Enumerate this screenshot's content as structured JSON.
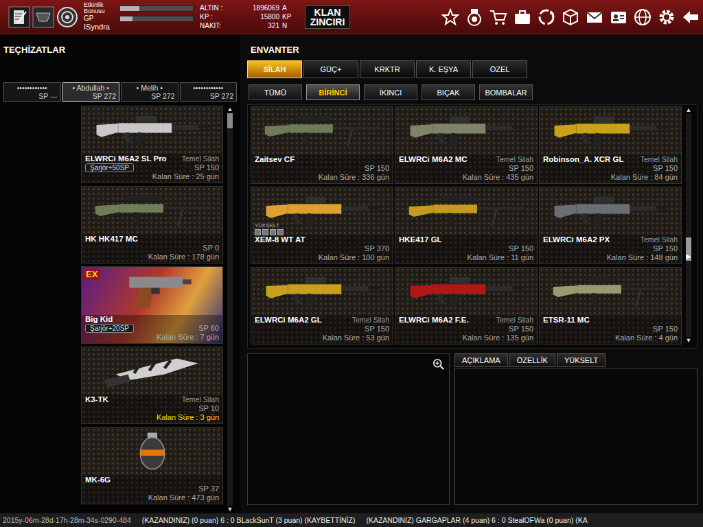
{
  "topbar": {
    "bonus": {
      "label": "Etkinlik Bonusu",
      "level": 0.26
    },
    "gp": {
      "label": "GP",
      "level": 0.17
    },
    "player": "ISyndra",
    "currencies": [
      {
        "label": "ALTIN :",
        "value": "1896069",
        "unit": "A"
      },
      {
        "label": "KP :",
        "value": "15800",
        "unit": "KP"
      },
      {
        "label": "NAKIT:",
        "value": "321",
        "unit": "N"
      }
    ],
    "clan_button": "KLAN ZINCIRI"
  },
  "equipment": {
    "title": "TEÇHİZATLAR",
    "characters": [
      {
        "name": "••••••••••••",
        "sp": "SP ---",
        "selected": false
      },
      {
        "name": "• Abdullah •",
        "sp": "SP 272",
        "selected": true
      },
      {
        "name": "• Melih •",
        "sp": "SP 272",
        "selected": false
      },
      {
        "name": "••••••••••••",
        "sp": "SP 272",
        "selected": false
      }
    ],
    "items": [
      {
        "name": "ELWRCi M6A2 SL Pro",
        "tag": "Temel Silah",
        "badge": "Şarjör+50SP",
        "sp": "SP 150",
        "remaining": "Kalan Süre : 25 gün",
        "kind": "rifle",
        "color": "#c8c8c8",
        "expiring": false
      },
      {
        "name": "HK HK417 MC",
        "sp": "SP 0",
        "remaining": "Kalan Süre : 178 gün",
        "kind": "sniper",
        "color": "#6f7d58",
        "expiring": false
      },
      {
        "name": "Big Kid",
        "ex": "EX",
        "badge": "Şarjör+20SP",
        "sp": "SP 60",
        "remaining": "Kalan Süre : 7 gün",
        "kind": "pistol",
        "color": "#8a8a8a",
        "expiring": false
      },
      {
        "name": "K3-TK",
        "tag": "Temel Silah",
        "sp": "SP 10",
        "remaining": "Kalan Süre : 3 gün",
        "kind": "knife",
        "color": "#d0d0d0",
        "expiring": true
      },
      {
        "name": "MK-6G",
        "sp": "SP 37",
        "remaining": "Kalan Süre : 473 gün",
        "kind": "grenade",
        "color": "#e07a10",
        "expiring": false
      }
    ],
    "scroll": {
      "level": 0,
      "up": "▲",
      "down": "▼"
    }
  },
  "inventory": {
    "title": "ENVANTER",
    "categories": [
      {
        "label": "SİLAH",
        "selected": true
      },
      {
        "label": "GÜÇ+",
        "selected": false
      },
      {
        "label": "KRKTR",
        "selected": false
      },
      {
        "label": "K. EŞYA",
        "selected": false
      },
      {
        "label": "ÖZEL",
        "selected": false
      }
    ],
    "subtabs": [
      {
        "label": "TÜMÜ",
        "selected": false
      },
      {
        "label": "BİRİNCİ",
        "selected": true
      },
      {
        "label": "İKINCI",
        "selected": false
      },
      {
        "label": "BIÇAK",
        "selected": false
      },
      {
        "label": "BOMBALAR",
        "selected": false
      }
    ],
    "items": [
      {
        "name": "Zaitsev CF",
        "sp": "SP 150",
        "remaining": "Kalan Süre : 336 gün",
        "kind": "sniper",
        "color": "#6e7a5a",
        "expiring": false
      },
      {
        "name": "ELWRCi M6A2 MC",
        "tag": "Temel Silah",
        "sp": "SP 150",
        "remaining": "Kalan Süre : 435 gün",
        "kind": "rifle",
        "color": "#7d8468",
        "expiring": false
      },
      {
        "name": "Robinson_A. XCR GL",
        "tag": "Temel Silah",
        "sp": "SP 150",
        "remaining": "Kalan Süre : 84 gün",
        "kind": "rifle",
        "color": "#c9a21a",
        "expiring": false
      },
      {
        "name": "XEM-8 WT AT",
        "upgrade": {
          "label": "YÜKSELT",
          "slots": 4
        },
        "sp": "SP 370",
        "remaining": "Kalan Süre : 100 gün",
        "kind": "rifle",
        "color": "#e0a030",
        "expiring": false
      },
      {
        "name": "HKE417 GL",
        "sp": "SP 150",
        "remaining": "Kalan Süre : 11 gün",
        "kind": "sniper",
        "color": "#c49a20",
        "expiring": false
      },
      {
        "name": "ELWRCi M6A2 PX",
        "tag": "Temel Silah",
        "sp": "SP 150",
        "remaining": "Kalan Süre : 148 gün",
        "kind": "rifle",
        "color": "#6a6e74",
        "expiring": false
      },
      {
        "name": "ELWRCi M6A2 GL",
        "tag": "Temel Silah",
        "sp": "SP 150",
        "remaining": "Kalan Süre : 53 gün",
        "kind": "rifle",
        "color": "#c8a020",
        "expiring": false
      },
      {
        "name": "ELWRCi M6A2 F.E.",
        "tag": "Temel Silah",
        "sp": "SP 150",
        "remaining": "Kalan Süre : 135 gün",
        "kind": "rifle",
        "color": "#b01818",
        "expiring": false
      },
      {
        "name": "ETSR-11 MC",
        "sp": "SP 150",
        "remaining": "Kalan Süre : 4 gün",
        "kind": "sniper",
        "color": "#9a9a70",
        "expiring": false
      }
    ],
    "scroll": {
      "level": 0.62,
      "up": "▲",
      "down": "▼",
      "side": "▶"
    },
    "detail_tabs": [
      {
        "label": "AÇIKLAMA",
        "selected": false
      },
      {
        "label": "ÖZELLİK",
        "selected": false
      },
      {
        "label": "YÜKSELT",
        "selected": false
      }
    ]
  },
  "ticker": {
    "timestamp": "2015y-06m-28d-17h-28m-34s-0290-484",
    "messages": [
      "(KAZANDINIZ) (0 puan) 6 : 0 BLackSunT (3 puan) (KAYBETTİNİZ)",
      "(KAZANDINIZ) GARGAPLAR (4 puan) 6 : 0 StealOFWa (0 puan) (KA"
    ]
  }
}
